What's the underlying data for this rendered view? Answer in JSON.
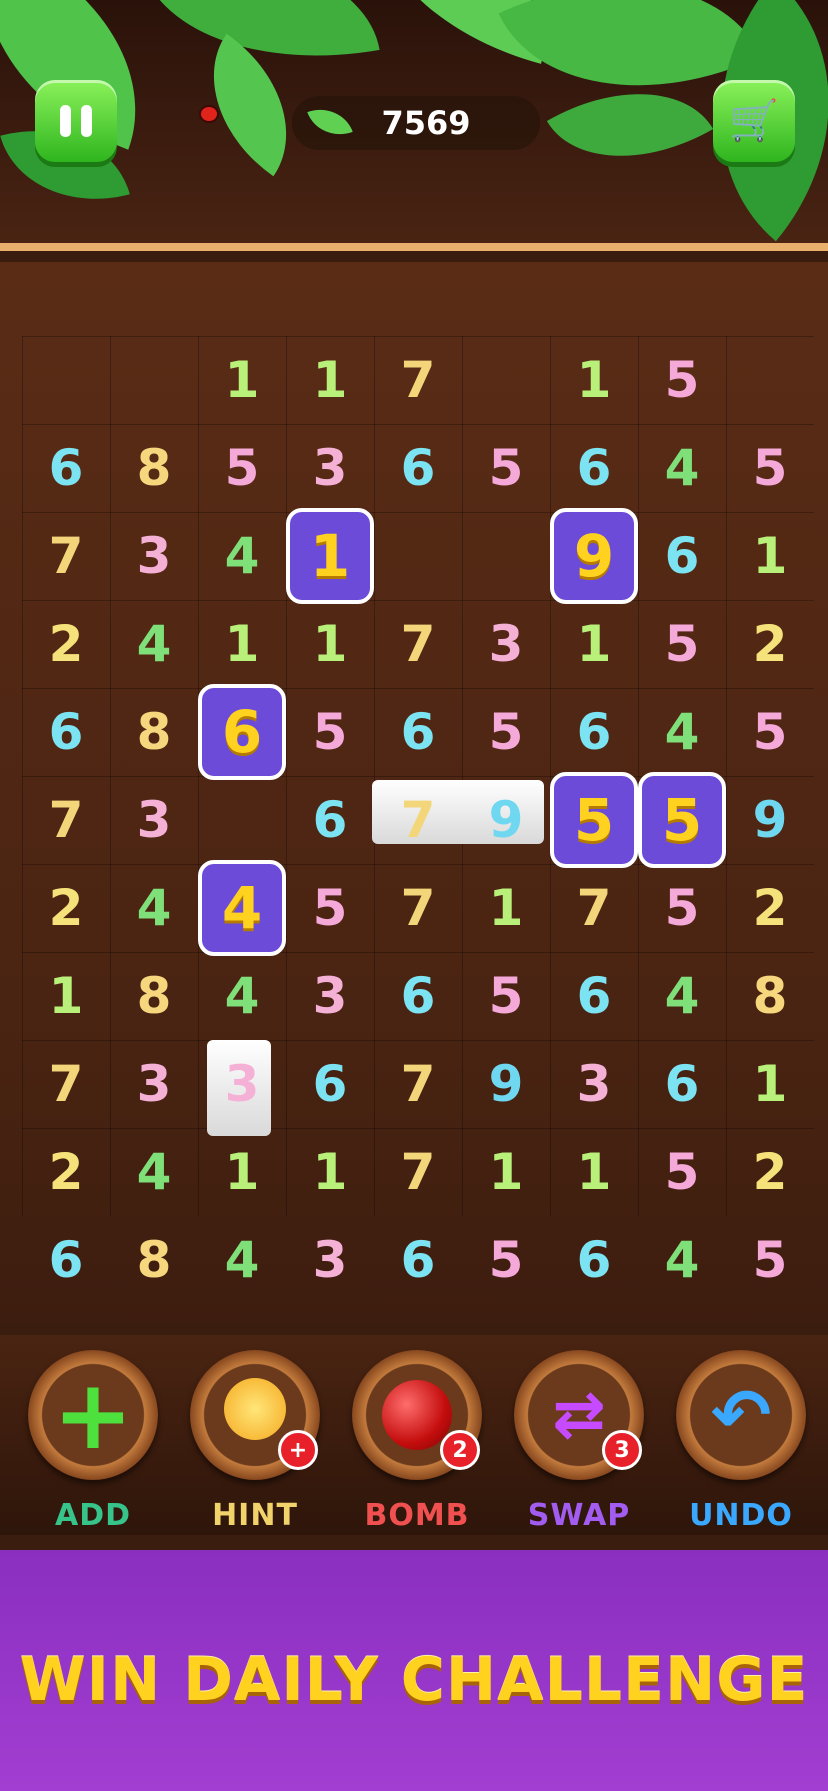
{
  "header": {
    "score": "7569",
    "pause_icon": "pause-icon",
    "shop_icon": "shopping-cart-icon"
  },
  "board": {
    "cols": 9,
    "rows": [
      [
        "",
        "",
        "1",
        "1",
        "7",
        "",
        "1",
        "5",
        ""
      ],
      [
        "6",
        "8",
        "5",
        "3",
        "6",
        "5",
        "6",
        "4",
        "5"
      ],
      [
        "7",
        "3",
        "4",
        "1",
        "",
        "",
        "9",
        "6",
        "1"
      ],
      [
        "2",
        "4",
        "1",
        "1",
        "7",
        "3",
        "1",
        "5",
        "2"
      ],
      [
        "6",
        "8",
        "6",
        "5",
        "6",
        "5",
        "6",
        "4",
        "5"
      ],
      [
        "7",
        "3",
        "",
        "6",
        "7",
        "9",
        "5",
        "5",
        "9"
      ],
      [
        "2",
        "4",
        "4",
        "5",
        "7",
        "1",
        "7",
        "5",
        "2"
      ],
      [
        "1",
        "8",
        "4",
        "3",
        "6",
        "5",
        "6",
        "4",
        "8"
      ],
      [
        "7",
        "3",
        "3",
        "6",
        "7",
        "9",
        "3",
        "6",
        "1"
      ],
      [
        "2",
        "4",
        "1",
        "1",
        "7",
        "1",
        "1",
        "5",
        "2"
      ],
      [
        "6",
        "8",
        "4",
        "3",
        "6",
        "5",
        "6",
        "4",
        "5"
      ]
    ],
    "selected": [
      [
        2,
        3
      ],
      [
        2,
        6
      ],
      [
        4,
        2
      ],
      [
        6,
        2
      ],
      [
        5,
        6
      ],
      [
        5,
        7
      ]
    ],
    "digit_colors": {
      "1": "#b8f07a",
      "2": "#f6e27a",
      "3": "#f5b0d6",
      "4": "#7fe07a",
      "5": "#f5a9d9",
      "6": "#7ce3f2",
      "7": "#f4d67a",
      "8": "#f7d77d",
      "9": "#6fd8f0"
    }
  },
  "tools": [
    {
      "id": "add",
      "label": "ADD",
      "icon": "plus-icon",
      "color": "#36c48a",
      "badge": ""
    },
    {
      "id": "hint",
      "label": "HINT",
      "icon": "light-bulb-icon",
      "color": "#f2d26b",
      "badge": "+"
    },
    {
      "id": "bomb",
      "label": "BOMB",
      "icon": "bomb-icon",
      "color": "#f05050",
      "badge": "2"
    },
    {
      "id": "swap",
      "label": "SWAP",
      "icon": "swap-arrows-icon",
      "color": "#a25cf0",
      "badge": "3"
    },
    {
      "id": "undo",
      "label": "UNDO",
      "icon": "undo-arrow-icon",
      "color": "#3aa8ff",
      "badge": ""
    }
  ],
  "banner": {
    "text": "WIN DAILY CHALLENGE"
  }
}
